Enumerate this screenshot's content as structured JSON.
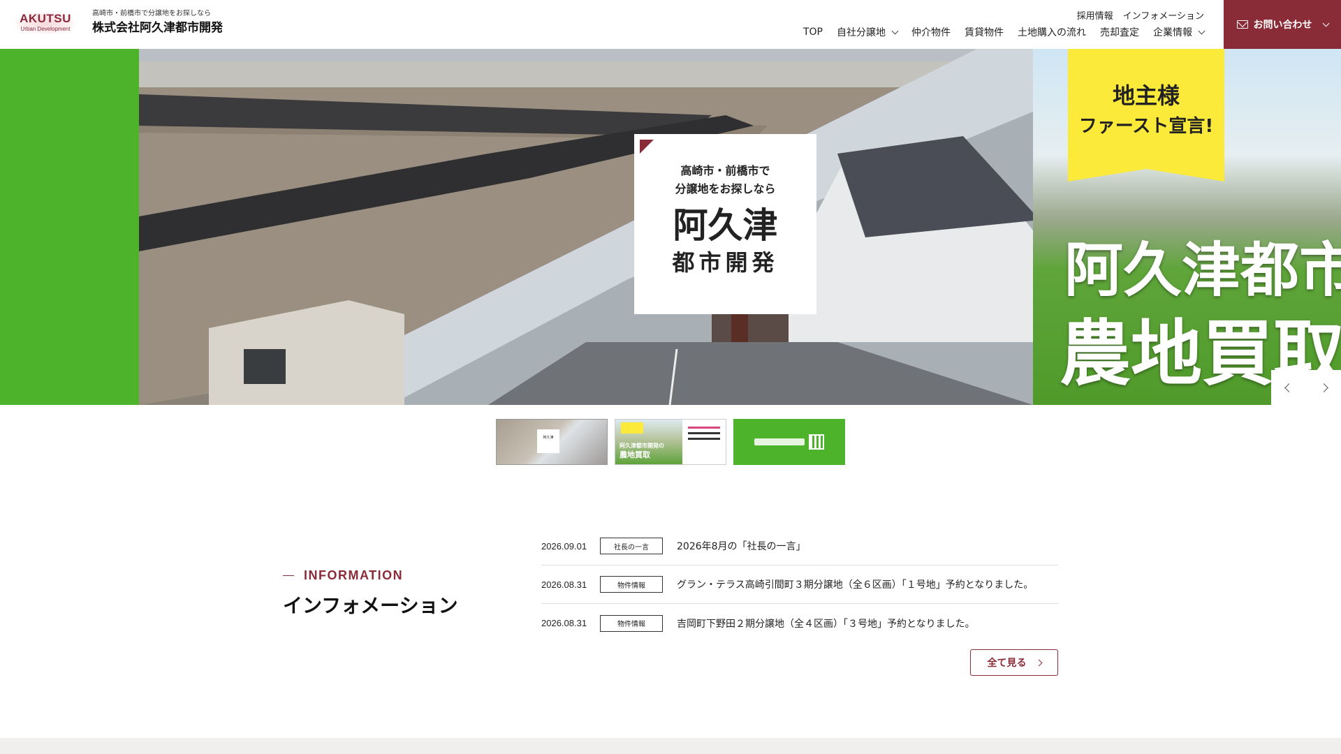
{
  "header": {
    "logo_brand": "AKUTSU",
    "logo_sub": "Urban Development",
    "tagline": "高崎市・前橋市で分譲地をお探しなら",
    "company": "株式会社阿久津都市開発",
    "util_nav": [
      "採用情報",
      "インフォメーション"
    ],
    "main_nav": [
      {
        "label": "TOP",
        "dropdown": false
      },
      {
        "label": "自社分譲地",
        "dropdown": true
      },
      {
        "label": "仲介物件",
        "dropdown": false
      },
      {
        "label": "賃貸物件",
        "dropdown": false
      },
      {
        "label": "土地購入の流れ",
        "dropdown": false
      },
      {
        "label": "売却査定",
        "dropdown": false
      },
      {
        "label": "企業情報",
        "dropdown": true
      }
    ],
    "contact_label": "お問い合わせ",
    "contact_icon": "mail-icon"
  },
  "hero": {
    "card_line1": "高崎市・前橋市で",
    "card_line2": "分譲地をお探しなら",
    "card_big1": "阿久津",
    "card_big2": "都市開発",
    "next_tag_line1": "地主様",
    "next_tag_line2": "ファースト宣言!",
    "next_big1": "阿久津都市",
    "next_big2": "農地買取"
  },
  "thumbnails": {
    "t1_text": "阿久津",
    "t2_text_line1": "阿久津都市開発の",
    "t2_text_line2": "農地買取"
  },
  "info": {
    "heading_en": "INFORMATION",
    "heading_jp": "インフォメーション",
    "items": [
      {
        "date": "2026.09.01",
        "category": "社長の一言",
        "title": "2026年8月の「社長の一言」"
      },
      {
        "date": "2026.08.31",
        "category": "物件情報",
        "title": "グラン・テラス高崎引間町３期分譲地（全６区画）「１号地」予約となりました。"
      },
      {
        "date": "2026.08.31",
        "category": "物件情報",
        "title": "吉岡町下野田２期分譲地（全４区画）「３号地」予約となりました。"
      }
    ],
    "view_all_label": "全て見る"
  },
  "colors": {
    "brand": "#8a2b38",
    "green": "#4cb32a",
    "yellow": "#fbea3a"
  }
}
